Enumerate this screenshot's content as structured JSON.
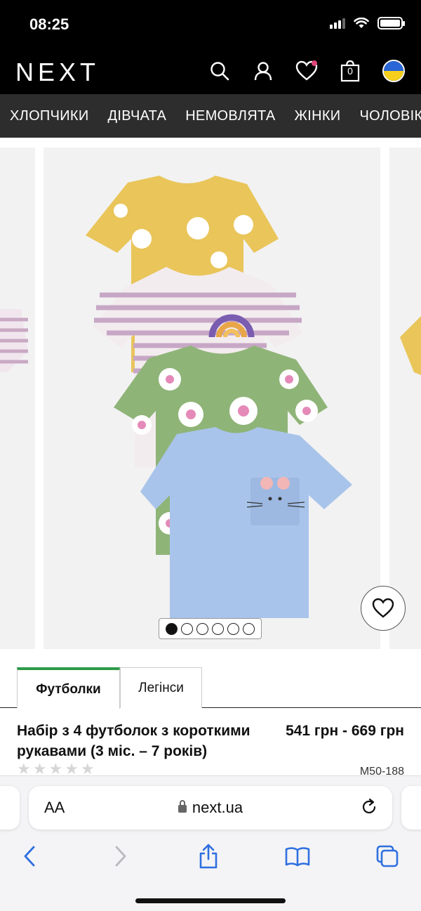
{
  "status_bar": {
    "time": "08:25"
  },
  "header": {
    "logo": "NEXT",
    "icons": [
      "search-icon",
      "account-icon",
      "wishlist-icon",
      "bag-icon",
      "ukraine-flag-icon"
    ],
    "bag_count": "0"
  },
  "categories": [
    "ХЛОПЧИКИ",
    "ДІВЧАТА",
    "НЕМОВЛЯТА",
    "ЖІНКИ",
    "ЧОЛОВІКИ"
  ],
  "gallery": {
    "slides": 6,
    "active_slide": 1
  },
  "tabs": [
    {
      "label": "Футболки",
      "active": true
    },
    {
      "label": "Легінси",
      "active": false
    }
  ],
  "product": {
    "title": "Набір з 4 футболок з короткими рукавами (3 міс. – 7 років)",
    "price": "541 грн - 669 грн",
    "code": "M50-188",
    "rating": 0,
    "stars": [
      "★",
      "★",
      "★",
      "★",
      "★"
    ]
  },
  "browser": {
    "text_size": "AA",
    "url": "next.ua"
  },
  "colors": {
    "accent_green": "#2e9a4a",
    "header_bg": "#000000",
    "nav_bg": "#2d2d2d"
  }
}
